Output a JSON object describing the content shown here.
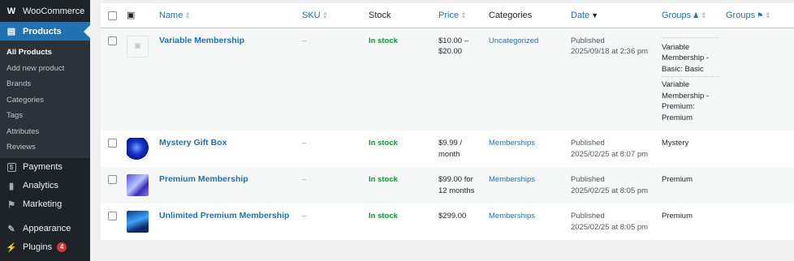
{
  "sidebar": {
    "woocommerce": "WooCommerce",
    "products": "Products",
    "submenu": [
      "All Products",
      "Add new product",
      "Brands",
      "Categories",
      "Tags",
      "Attributes",
      "Reviews"
    ],
    "payments": "Payments",
    "analytics": "Analytics",
    "marketing": "Marketing",
    "appearance": "Appearance",
    "plugins": "Plugins",
    "plugins_badge": "4"
  },
  "table": {
    "headers": {
      "name": "Name",
      "sku": "SKU",
      "stock": "Stock",
      "price": "Price",
      "categories": "Categories",
      "date": "Date",
      "groups1": "Groups",
      "groups2": "Groups"
    },
    "rows": [
      {
        "name": "Variable Membership",
        "sku": "–",
        "stock": "In stock",
        "price_line1": "$10.00 –",
        "price_line2": "$20.00",
        "category": "Uncategorized",
        "date_status": "Published",
        "date": "2025/09/18 at 2:36 pm",
        "groups": [
          "Variable Membership - Basic: Basic",
          "Variable Membership - Premium: Premium"
        ]
      },
      {
        "name": "Mystery Gift Box",
        "sku": "–",
        "stock": "In stock",
        "price_line1": "$9.99 /",
        "price_line2": "month",
        "category": "Memberships",
        "date_status": "Published",
        "date": "2025/02/25 at 8:07 pm",
        "groups": [
          "Mystery"
        ]
      },
      {
        "name": "Premium Membership",
        "sku": "–",
        "stock": "In stock",
        "price_line1": "$99.00 for",
        "price_line2": "12 months",
        "category": "Memberships",
        "date_status": "Published",
        "date": "2025/02/25 at 8:05 pm",
        "groups": [
          "Premium"
        ]
      },
      {
        "name": "Unlimited Premium Membership",
        "sku": "–",
        "stock": "In stock",
        "price_line1": "$299.00",
        "price_line2": "",
        "category": "Memberships",
        "date_status": "Published",
        "date": "2025/02/25 at 8:05 pm",
        "groups": [
          "Premium"
        ]
      }
    ]
  },
  "icons": [
    "woo-logo-icon",
    "products-icon",
    "payments-icon",
    "analytics-icon",
    "marketing-icon",
    "appearance-icon",
    "plugins-icon",
    "image-icon",
    "user-icon",
    "lock-icon",
    "sort-icon"
  ],
  "colors": {
    "accent": "#2271b1",
    "sidebar": "#1d2327",
    "instock": "#00a32a",
    "badge": "#d63638"
  }
}
